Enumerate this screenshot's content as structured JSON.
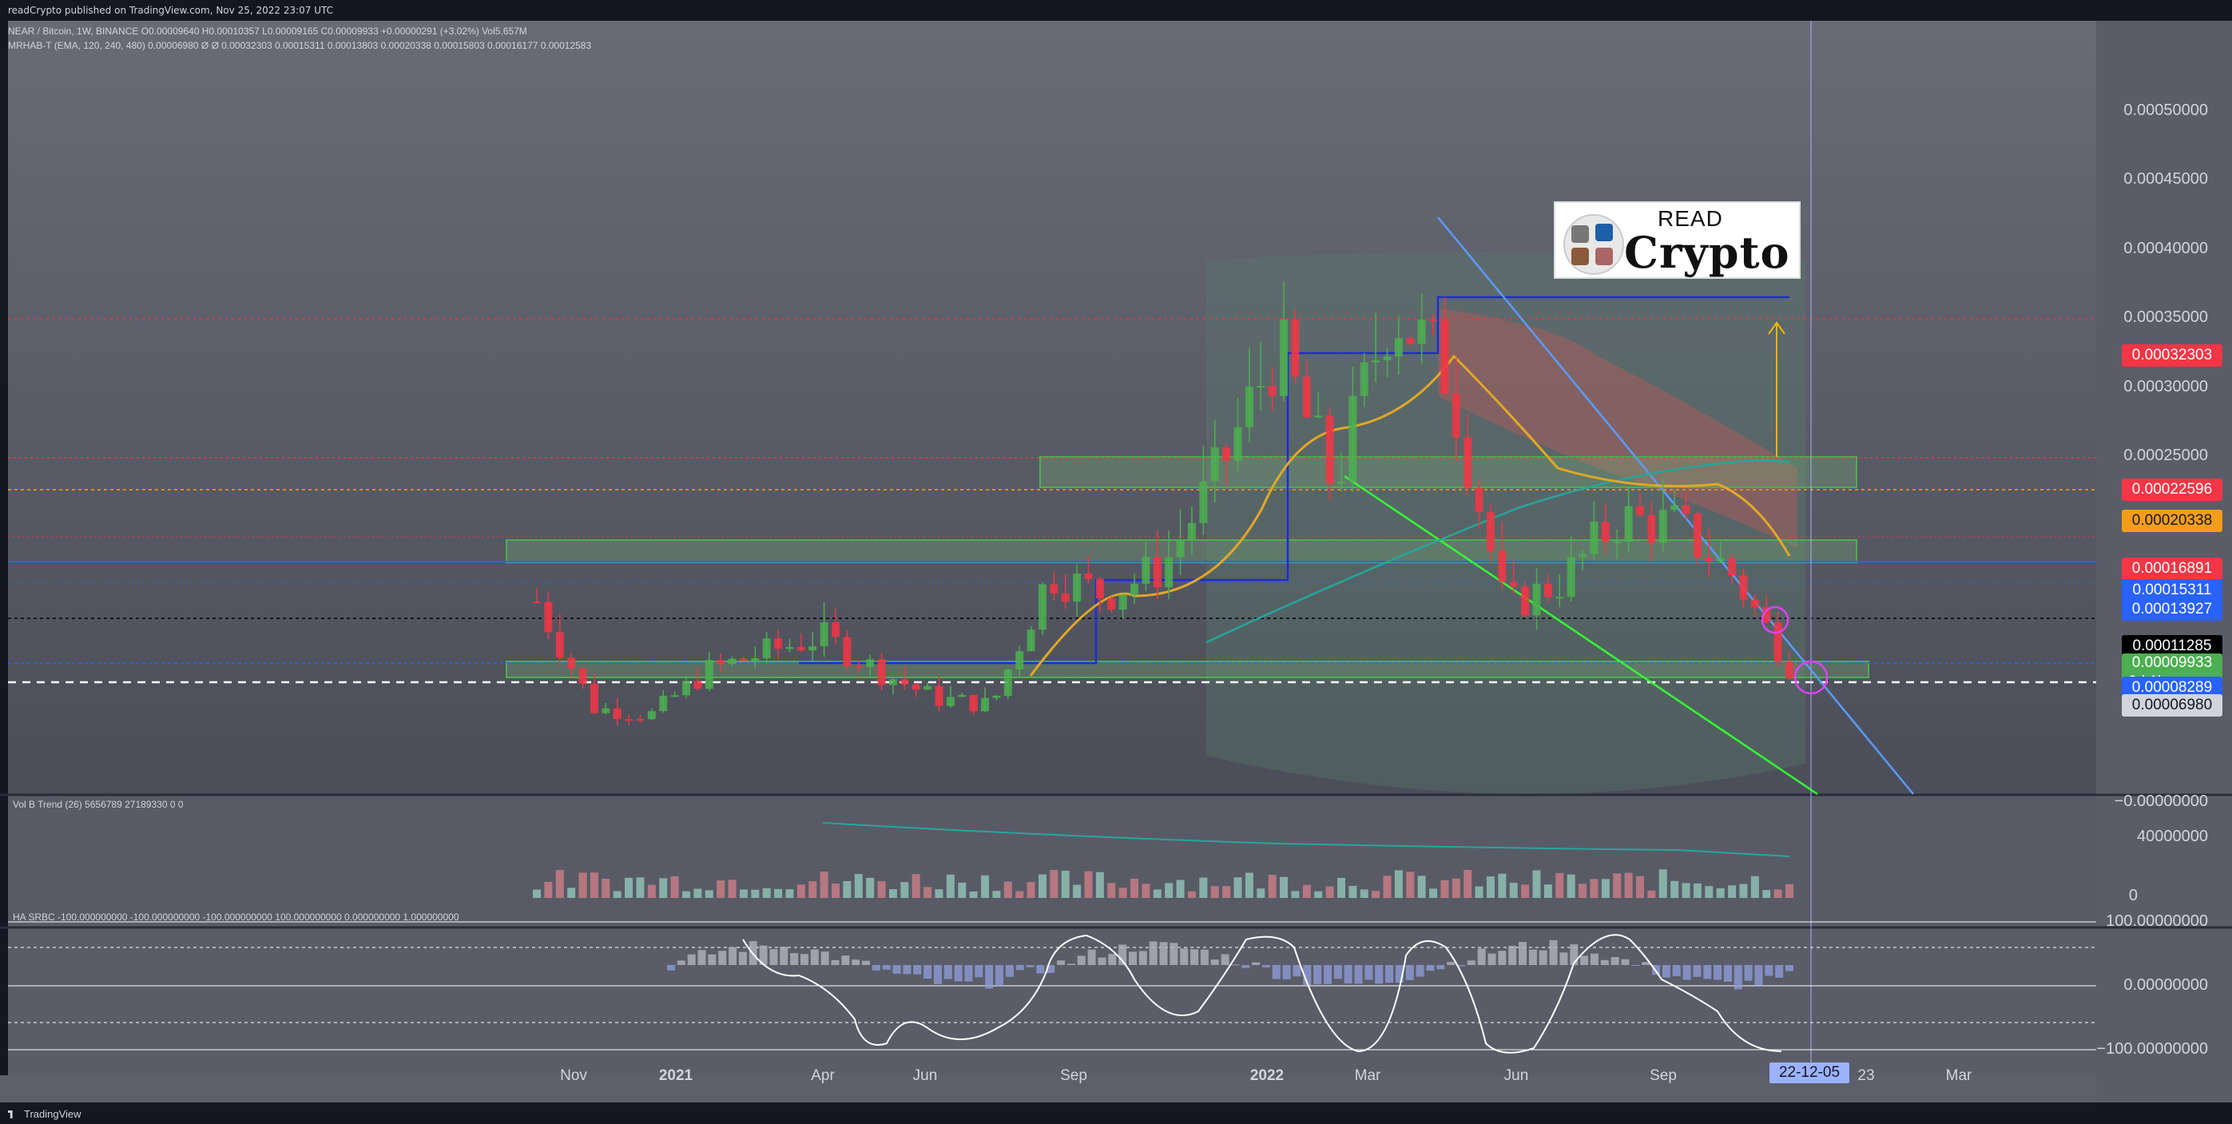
{
  "header": {
    "publish_text": "readCrypto published on TradingView.com, Nov 25, 2022 23:07 UTC"
  },
  "legends": {
    "main": "NEAR / Bitcoin, 1W, BINANCE  O0.00009640  H0.00010357  L0.00009165  C0.00009933  +0.00000291 (+3.02%)  Vol5.657M",
    "mrhab": "MRHAB-T (EMA, 120, 240, 480)  0.00006980  Ø  Ø  0.00032303  0.00015311  0.00013803  0.00020338  0.00015803  0.00016177  0.00012583",
    "vol": "Vol B Trend (26)  5656789  27189330  0  0",
    "ha": "HA SRBC  -100.000000000  -100.000000000  -100.000000000  100.000000000  0.000000000  1.000000000"
  },
  "logo": {
    "read": "READ",
    "crypto": "Crypto"
  },
  "footer": {
    "brand": "TradingView"
  },
  "colors": {
    "bg": "#5d606b",
    "red": "#f23645",
    "green": "#4caf50",
    "blue": "#2962ff",
    "orange": "#f59d1a",
    "teal": "#26a69a"
  },
  "price_axis": [
    {
      "label": "0.00050000",
      "value": 0.0005
    },
    {
      "label": "0.00045000",
      "value": 0.00045
    },
    {
      "label": "0.00040000",
      "value": 0.0004
    },
    {
      "label": "0.00035000",
      "value": 0.00035
    },
    {
      "label": "0.00030000",
      "value": 0.0003
    },
    {
      "label": "0.00025000",
      "value": 0.00025
    },
    {
      "label": "−0.00000000",
      "value": 0.0
    }
  ],
  "price_labels": [
    {
      "label": "0.00032303",
      "value": 0.00032303,
      "bg": "#f23645",
      "fg": "#ffffff"
    },
    {
      "label": "0.00022596",
      "value": 0.00022596,
      "bg": "#f23645",
      "fg": "#ffffff"
    },
    {
      "label": "0.00020338",
      "value": 0.00020338,
      "bg": "#f59d1a",
      "fg": "#131722"
    },
    {
      "label": "0.00016891",
      "value": 0.00016891,
      "bg": "#f23645",
      "fg": "#ffffff"
    },
    {
      "label": "0.00015311",
      "value": 0.00015311,
      "bg": "#2962ff",
      "fg": "#ffffff"
    },
    {
      "label": "0.00013927",
      "value": 0.00013927,
      "bg": "#2962ff",
      "fg": "#ffffff"
    },
    {
      "label": "0.00011285",
      "value": 0.00011285,
      "bg": "#000000",
      "fg": "#ffffff"
    },
    {
      "label": "0.00009933",
      "value": 9.933e-05,
      "bg": "#4caf50",
      "fg": "#ffffff",
      "sub": "2d 1h"
    },
    {
      "label": "0.00008289",
      "value": 8.289e-05,
      "bg": "#2962ff",
      "fg": "#ffffff"
    },
    {
      "label": "0.00006980",
      "value": 6.98e-05,
      "bg": "#d1d4dc",
      "fg": "#131722"
    }
  ],
  "vol_axis": [
    {
      "label": "40000000",
      "value": 40000000
    },
    {
      "label": "0",
      "value": 0
    }
  ],
  "ha_axis": [
    {
      "label": "100.00000000",
      "value": 100
    },
    {
      "label": "0.00000000",
      "value": 0
    },
    {
      "label": "−100.00000000",
      "value": -100
    }
  ],
  "time_axis": [
    {
      "label": "Nov"
    },
    {
      "label": "2021"
    },
    {
      "label": "Apr"
    },
    {
      "label": "Jun"
    },
    {
      "label": "Sep"
    },
    {
      "label": "2022"
    },
    {
      "label": "Mar"
    },
    {
      "label": "Jun"
    },
    {
      "label": "Sep"
    },
    {
      "label": "22-12-05",
      "highlight": true
    },
    {
      "label": "23"
    },
    {
      "label": "Mar"
    }
  ],
  "chart_data": {
    "type": "candlestick",
    "title": "NEAR / Bitcoin, 1W, BINANCE",
    "ylim": [
      0.0,
      0.00052
    ],
    "x": [
      "2020-10-12",
      "2020-11-16",
      "2020-12-21",
      "2021-01-25",
      "2021-03-01",
      "2021-04-05",
      "2021-05-10",
      "2021-06-14",
      "2021-07-19",
      "2021-08-23",
      "2021-09-27",
      "2021-11-01",
      "2021-12-06",
      "2022-01-10",
      "2022-02-14",
      "2022-03-21",
      "2022-04-25",
      "2022-05-30",
      "2022-07-04",
      "2022-08-08",
      "2022-09-12",
      "2022-10-17",
      "2022-11-21"
    ],
    "close": [
      0.000145,
      6.8e-05,
      6.3e-05,
      9.5e-05,
      0.000108,
      0.00012,
      9.5e-05,
      7.5e-05,
      7e-05,
      0.000165,
      0.00015,
      0.00017,
      0.00024,
      0.00033,
      0.000228,
      0.00036,
      0.00031,
      0.00014,
      0.00016,
      0.000205,
      0.0002,
      0.000165,
      9.93e-05
    ],
    "horizontal_levels": [
      0.00032303,
      0.00022596,
      0.00020338,
      0.00016891,
      0.00015311,
      0.00013927,
      0.00011285,
      8.289e-05,
      6.98e-05
    ],
    "annotations": [
      "support/resistance boxes",
      "descending trendline",
      "upward target arrow to 0.00032303"
    ]
  }
}
